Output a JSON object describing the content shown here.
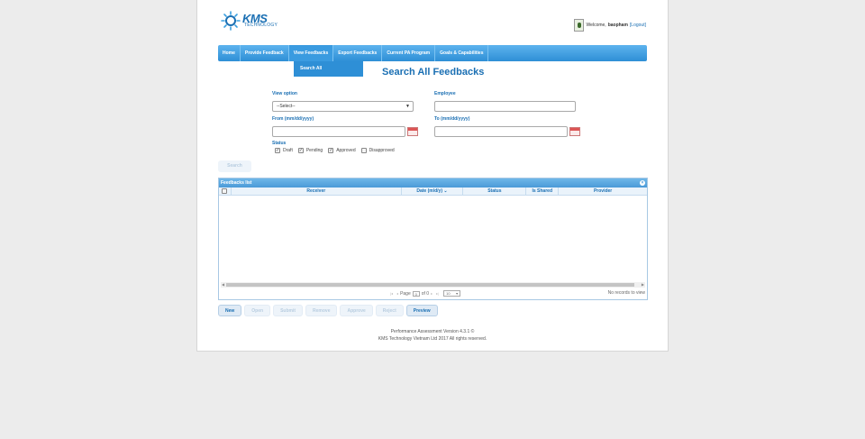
{
  "header": {
    "logo_text": "KMS",
    "logo_sub": "TECHNOLOGY",
    "welcome_prefix": "Welcome,",
    "username": "baopham",
    "logout": "[Logout]"
  },
  "nav": {
    "items": [
      "Home",
      "Provide Feedback",
      "View Feedbacks",
      "Export Feedbacks",
      "Current PA Program",
      "Goals & Capabilities"
    ],
    "submenu": "Search All"
  },
  "page_title": "Search All Feedbacks",
  "form": {
    "view_option_label": "View option",
    "view_option_value": "--Select--",
    "employee_label": "Employee",
    "from_label": "From (mm/dd/yyyy)",
    "to_label": "To (mm/dd/yyyy)",
    "status_label": "Status",
    "statuses": [
      {
        "label": "Draft",
        "checked": true
      },
      {
        "label": "Pending",
        "checked": true
      },
      {
        "label": "Approved",
        "checked": true
      },
      {
        "label": "Disapproved",
        "checked": false
      }
    ],
    "search_button": "Search"
  },
  "grid": {
    "title": "Feedbacks list",
    "columns": [
      "Receiver",
      "Date (m/d/y)",
      "Status",
      "Is Shared",
      "Provider"
    ],
    "sort_indicator": "⌄",
    "pager": {
      "page_label": "Page",
      "page_value": "0",
      "of_label": "of 0",
      "page_size": "10",
      "records": "No records to view"
    }
  },
  "actions": [
    "New",
    "Open",
    "Submit",
    "Remove",
    "Approve",
    "Reject",
    "Preview"
  ],
  "footer": {
    "line1": "Performance Assessment Version 4.3.1 ©",
    "line2": "KMS Technology Vietnam Ltd 2017 All rights reserved."
  }
}
